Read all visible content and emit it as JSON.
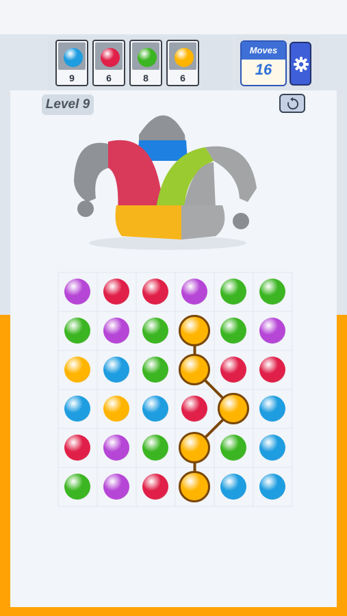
{
  "colors": {
    "blue": "#1e9de0",
    "red": "#e02048",
    "green": "#3cb522",
    "yellow": "#ffb400",
    "purple": "#b646d6",
    "orange_band": "#ffa205",
    "moves_accent": "#3d6fd6",
    "path_line": "#7a4608"
  },
  "goals": [
    {
      "color": "blue",
      "count": "9"
    },
    {
      "color": "red",
      "count": "6"
    },
    {
      "color": "green",
      "count": "8"
    },
    {
      "color": "yellow",
      "count": "6"
    }
  ],
  "moves": {
    "label": "Moves",
    "value": "16"
  },
  "level": {
    "label": "Level 9"
  },
  "icons": {
    "settings": "gear-icon",
    "restart": "restart-icon"
  },
  "target_picture": "jester-hat",
  "board": {
    "rows": [
      [
        "purple",
        "red",
        "red",
        "purple",
        "green",
        "green"
      ],
      [
        "green",
        "purple",
        "green",
        "yellow",
        "green",
        "purple"
      ],
      [
        "yellow",
        "blue",
        "green",
        "yellow",
        "red",
        "red"
      ],
      [
        "blue",
        "yellow",
        "blue",
        "red",
        "yellow",
        "blue"
      ],
      [
        "red",
        "purple",
        "green",
        "yellow",
        "green",
        "blue"
      ],
      [
        "green",
        "purple",
        "red",
        "yellow",
        "blue",
        "blue"
      ]
    ],
    "selected_path": [
      [
        1,
        3
      ],
      [
        2,
        3
      ],
      [
        3,
        4
      ],
      [
        4,
        3
      ],
      [
        5,
        3
      ]
    ]
  }
}
